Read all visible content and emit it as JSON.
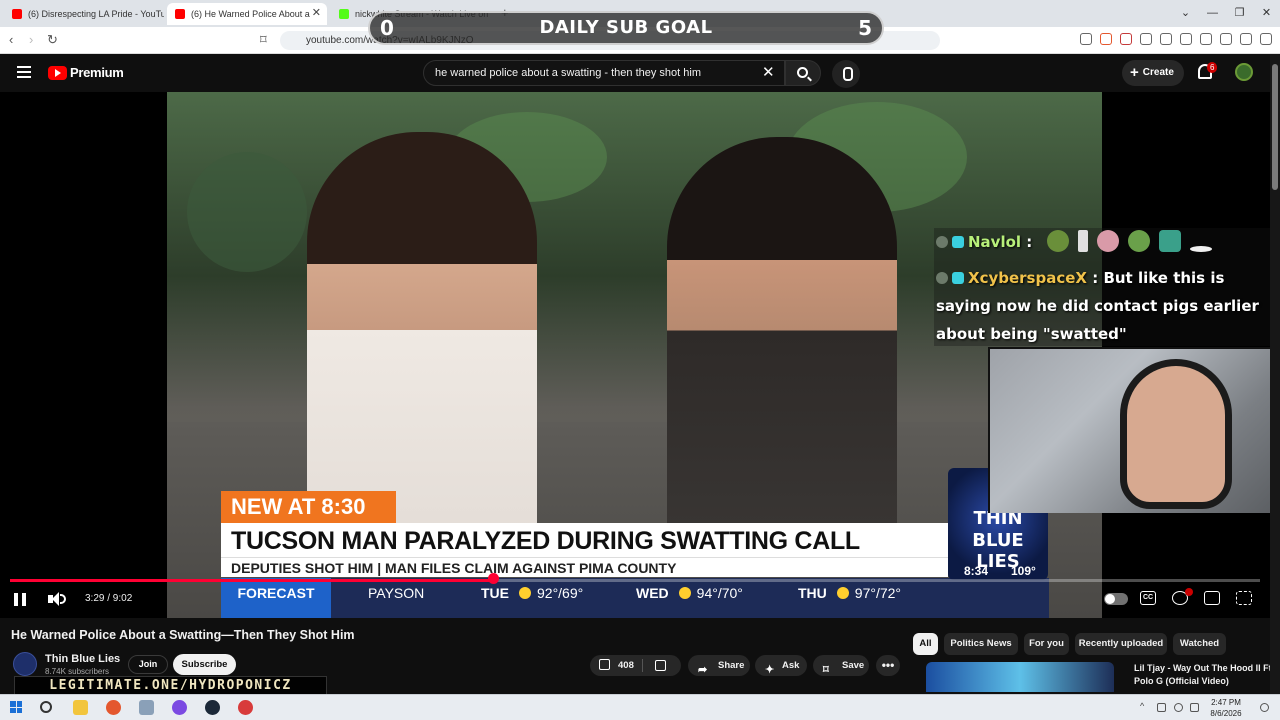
{
  "browser": {
    "tabs": [
      {
        "title": "(6) Disrespecting LA Pride - YouTube",
        "favicon_color": "#ff0000",
        "active": false
      },
      {
        "title": "(6) He Warned Police About a Swatting",
        "favicon_color": "#ff0000",
        "active": true
      },
      {
        "title": "nickwhite Stream - Watch Live on Kick",
        "favicon_color": "#53fc18",
        "active": false
      }
    ],
    "new_tab_symbol": "+",
    "url": "youtube.com/watch?v=wIALb9KJNzQ",
    "window_controls": [
      "⌄",
      "—",
      "❐",
      "✕"
    ]
  },
  "masthead": {
    "logo_text": "Premium",
    "search_query": "he warned police about a swatting - then they shot him",
    "clear_symbol": "✕",
    "create_label": "Create",
    "notification_count": "6"
  },
  "stream_overlay": {
    "goal_current": "0",
    "goal_title": "DAILY SUB GOAL",
    "goal_target": "5",
    "chat": [
      {
        "user": "Navlol",
        "separator": ":",
        "message": "",
        "user_color": "#b8f07a",
        "emotes": [
          "#6a8f3a",
          "#e0e0e0",
          "#d99aa8",
          "#6aa04a",
          "#3aa08a",
          "#f0f0f0"
        ]
      },
      {
        "user": "XcyberspaceX",
        "separator": ":",
        "message": "But like this is saying now he did contact pigs earlier about being \"swatted\"",
        "user_color": "#f0c24a"
      }
    ],
    "badge_colors": [
      "#6c7a6a",
      "#3ad0e0"
    ]
  },
  "news": {
    "kicker": "NEW AT 8:30",
    "headline": "TUCSON MAN PARALYZED DURING SWATTING CALL",
    "subline": "DEPUTIES SHOT HIM | MAN FILES CLAIM AGAINST PIMA COUNTY",
    "forecast_label": "FORECAST",
    "forecast": [
      {
        "day": "",
        "city": "PAYSON",
        "temps": ""
      },
      {
        "day": "TUE",
        "temps": "92°/69°"
      },
      {
        "day": "WED",
        "temps": "94°/70°"
      },
      {
        "day": "THU",
        "temps": "97°/72°"
      }
    ],
    "station_line1": "THIN",
    "station_line2": "BLUE LIES",
    "station_time": "8:34",
    "station_temp": "109°"
  },
  "player": {
    "current_time": "3:29",
    "duration": "9:02",
    "time_text": "3:29 / 9:02",
    "progress_fraction": 0.386,
    "accent": "#ff0033",
    "cc_label": "CC"
  },
  "video": {
    "title": "He Warned Police About a Swatting—Then They Shot Him",
    "channel_name": "Thin Blue Lies",
    "subscribers": "8.74K subscribers",
    "join_label": "Join",
    "subscribe_label": "Subscribe",
    "like_count": "408",
    "share_label": "Share",
    "ask_label": "Ask",
    "save_label": "Save",
    "more_symbol": "•••"
  },
  "promo_banner": "LEGITIMATE.ONE/HYDROPONICZ",
  "filter_chips": [
    {
      "label": "All",
      "active": true
    },
    {
      "label": "Politics News",
      "active": false
    },
    {
      "label": "For you",
      "active": false
    },
    {
      "label": "Recently uploaded",
      "active": false
    },
    {
      "label": "Watched",
      "active": false
    }
  ],
  "recommendation": {
    "title": "Lil Tjay - Way Out The Hood II Ft Polo G (Official Video)"
  },
  "taskbar": {
    "time": "2:47 PM",
    "date": "8/6/2026"
  }
}
